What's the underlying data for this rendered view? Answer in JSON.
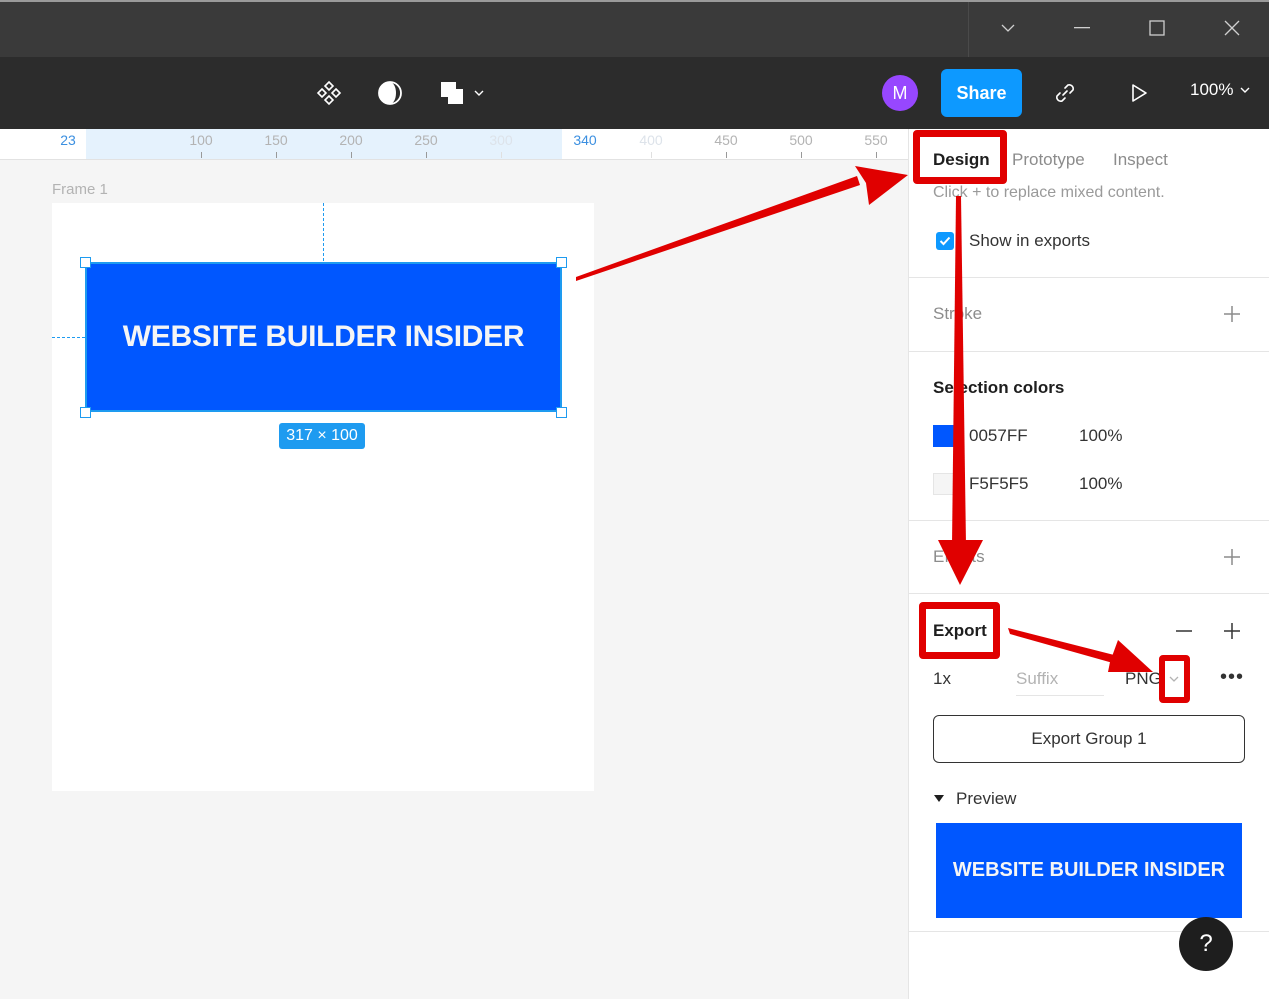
{
  "window": {
    "controls": [
      "chevron-down",
      "minimize",
      "maximize",
      "close"
    ]
  },
  "toolbar": {
    "tools": [
      "components-icon",
      "contrast-icon",
      "boolean-shapes-icon"
    ],
    "avatar_initial": "M",
    "avatar_color": "#9747ff",
    "share_label": "Share",
    "share_color": "#0d99ff",
    "zoom_level": "100%"
  },
  "ruler": {
    "ticks": [
      {
        "label": "23",
        "state": "active"
      },
      {
        "label": "100",
        "state": "normal"
      },
      {
        "label": "150",
        "state": "normal"
      },
      {
        "label": "200",
        "state": "normal"
      },
      {
        "label": "250",
        "state": "normal"
      },
      {
        "label": "300",
        "state": "faint"
      },
      {
        "label": "340",
        "state": "active"
      },
      {
        "label": "400",
        "state": "faint"
      },
      {
        "label": "450",
        "state": "normal"
      },
      {
        "label": "500",
        "state": "normal"
      },
      {
        "label": "550",
        "state": "normal"
      }
    ]
  },
  "canvas": {
    "frame_name": "Frame 1",
    "banner_text": "WEBSITE BUILDER INSIDER",
    "banner_color": "#0057ff",
    "selection_size": "317 × 100"
  },
  "panel": {
    "tabs": [
      {
        "label": "Design",
        "active": true
      },
      {
        "label": "Prototype",
        "active": false
      },
      {
        "label": "Inspect",
        "active": false
      }
    ],
    "hint": "Click + to replace mixed content.",
    "show_in_exports": {
      "label": "Show in exports",
      "checked": true
    },
    "stroke": {
      "title": "Stroke"
    },
    "selection_colors": {
      "title": "Selection colors",
      "colors": [
        {
          "hex": "0057FF",
          "opacity": "100%",
          "swatch": "#0057ff"
        },
        {
          "hex": "F5F5F5",
          "opacity": "100%",
          "swatch": "#f5f5f5"
        }
      ]
    },
    "effects": {
      "title": "Effects"
    },
    "export": {
      "title": "Export",
      "scale": "1x",
      "suffix_placeholder": "Suffix",
      "format": "PNG",
      "export_button": "Export Group 1",
      "preview_label": "Preview",
      "preview_text": "WEBSITE BUILDER INSIDER"
    },
    "help_label": "?"
  },
  "annotation_color": "#e00000"
}
